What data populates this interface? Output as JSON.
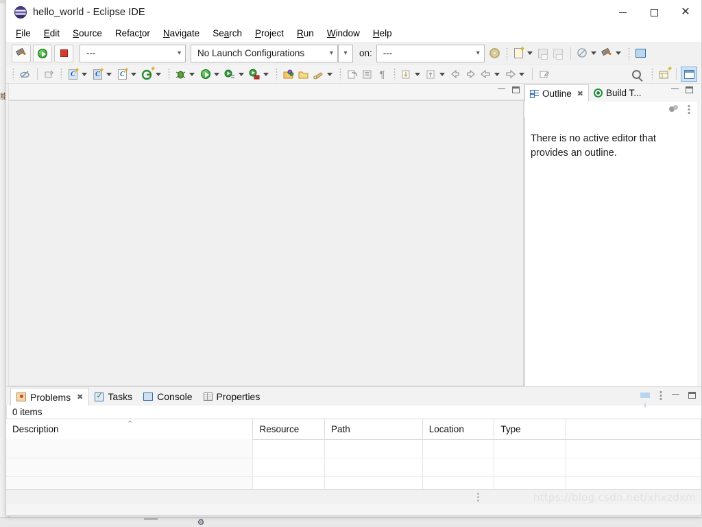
{
  "window": {
    "title": "hello_world - Eclipse IDE",
    "app_icon": "eclipse-logo-icon",
    "minimize_label": "",
    "maximize_label": "",
    "close_label": "✕"
  },
  "menubar": {
    "items": [
      {
        "label": "File",
        "mnemonic_index": 0
      },
      {
        "label": "Edit",
        "mnemonic_index": 0
      },
      {
        "label": "Source",
        "mnemonic_index": 0
      },
      {
        "label": "Refactor",
        "mnemonic_index": 5
      },
      {
        "label": "Navigate",
        "mnemonic_index": 0
      },
      {
        "label": "Search",
        "mnemonic_index": 2
      },
      {
        "label": "Project",
        "mnemonic_index": 0
      },
      {
        "label": "Run",
        "mnemonic_index": 0
      },
      {
        "label": "Window",
        "mnemonic_index": 0
      },
      {
        "label": "Help",
        "mnemonic_index": 0
      }
    ]
  },
  "toolbar_primary": {
    "build_button": "build-hammer-icon",
    "run_button": "run-green-play-icon",
    "stop_button": "stop-red-square-icon",
    "mode_combo_value": "---",
    "launch_combo_value": "No Launch Configurations",
    "on_label": "on:",
    "target_combo_value": "---",
    "settings_button": "launch-settings-gear-icon",
    "new_button": "new-wizard-icon",
    "save_button": "save-icon",
    "save_all_button": "save-all-icon",
    "skip_breakpoints_button": "skip-all-breakpoints-icon",
    "build_all_button": "build-all-hammer-icon",
    "open_console_button": "open-console-icon"
  },
  "toolbar_secondary": {
    "buttons": [
      "toggle-mark-occurrences-icon",
      "open-type-icon",
      "new-c-class-icon",
      "new-c-project-icon",
      "new-c-file-icon",
      "new-git-icon",
      "debug-icon",
      "run-icon",
      "run-last-tool-icon",
      "run-remote-icon",
      "open-resource-icon",
      "open-folder-icon",
      "build-configuration-icon",
      "export-icon",
      "book-icon",
      "pilcrow-icon",
      "next-annotation-icon",
      "previous-annotation-icon",
      "back-arrow-icon",
      "forward-arrow-icon",
      "prev-edit-icon",
      "next-edit-icon",
      "new-untitled-file-icon",
      "search-icon",
      "new-perspective-icon",
      "c-cpp-perspective-icon"
    ]
  },
  "editor_area": {
    "minimize_label": "",
    "restore_label": "",
    "content": ""
  },
  "right_panel": {
    "tabs": [
      {
        "label": "Outline",
        "icon": "outline-icon",
        "active": true,
        "closable": true
      },
      {
        "label": "Build T...",
        "icon": "build-targets-icon",
        "active": false,
        "closable": false
      }
    ],
    "toolbar": [
      "sort-toggle-icon",
      "view-menu-icon"
    ],
    "empty_message": "There is no active editor that provides an outline."
  },
  "bottom_panel": {
    "tabs": [
      {
        "label": "Problems",
        "icon": "problems-icon",
        "active": true,
        "closable": true
      },
      {
        "label": "Tasks",
        "icon": "tasks-icon",
        "active": false,
        "closable": false
      },
      {
        "label": "Console",
        "icon": "console-icon",
        "active": false,
        "closable": false
      },
      {
        "label": "Properties",
        "icon": "properties-icon",
        "active": false,
        "closable": false
      }
    ],
    "toolbar": [
      "filter-icon",
      "view-menu-icon",
      "minimize-icon",
      "maximize-icon"
    ],
    "items_count": "0 items",
    "table": {
      "columns": [
        "Description",
        "Resource",
        "Path",
        "Location",
        "Type"
      ],
      "sort_column": "Description",
      "sort_direction": "ascending",
      "sort_indicator": "⌃",
      "rows": []
    }
  },
  "statusbar": {
    "watermark": "https://blog.csdn.net/xhxzdxm"
  },
  "background_window": {
    "side_text": "能分用更"
  },
  "colors": {
    "window_bg": "#f5f5f5",
    "titlebar_bg": "#ffffff",
    "tab_active_bg": "#ffffff",
    "accent_blue": "#cfe3f7",
    "run_green": "#1d8f22",
    "stop_red": "#d83a2e",
    "text": "#111111",
    "watermark": "#e2e2e2"
  }
}
